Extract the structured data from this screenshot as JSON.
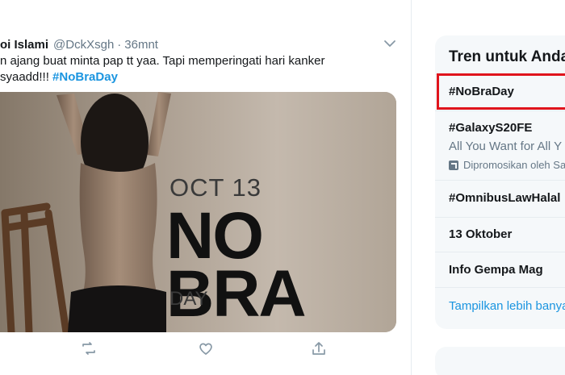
{
  "tweet": {
    "author_name": "oi Islami",
    "author_handle": "@DckXsgh",
    "separator": "·",
    "time": "36mnt",
    "text_line1": "n ajang buat minta pap tt yaa. Tapi memperingati hari kanker",
    "text_line2_prefix": "syaadd!!! ",
    "hashtag": "#NoBraDay",
    "image": {
      "date": "OCT 13",
      "word1": "NO",
      "word2": "BRA",
      "word3": "DAY"
    }
  },
  "trends": {
    "title": "Tren untuk Anda",
    "items": [
      {
        "name": "#NoBraDay"
      },
      {
        "name": "#GalaxyS20FE",
        "subtitle": "All You Want for All Y",
        "promoted": "Dipromosikan oleh Sa"
      },
      {
        "name": "#OmnibusLawHalal"
      },
      {
        "name": "13 Oktober"
      },
      {
        "name": "Info Gempa Mag"
      }
    ],
    "show_more": "Tampilkan lebih banyak"
  },
  "colors": {
    "accent": "#1b95e0",
    "highlight": "#e0141c",
    "muted": "#657786",
    "panel": "#f5f8fa"
  }
}
